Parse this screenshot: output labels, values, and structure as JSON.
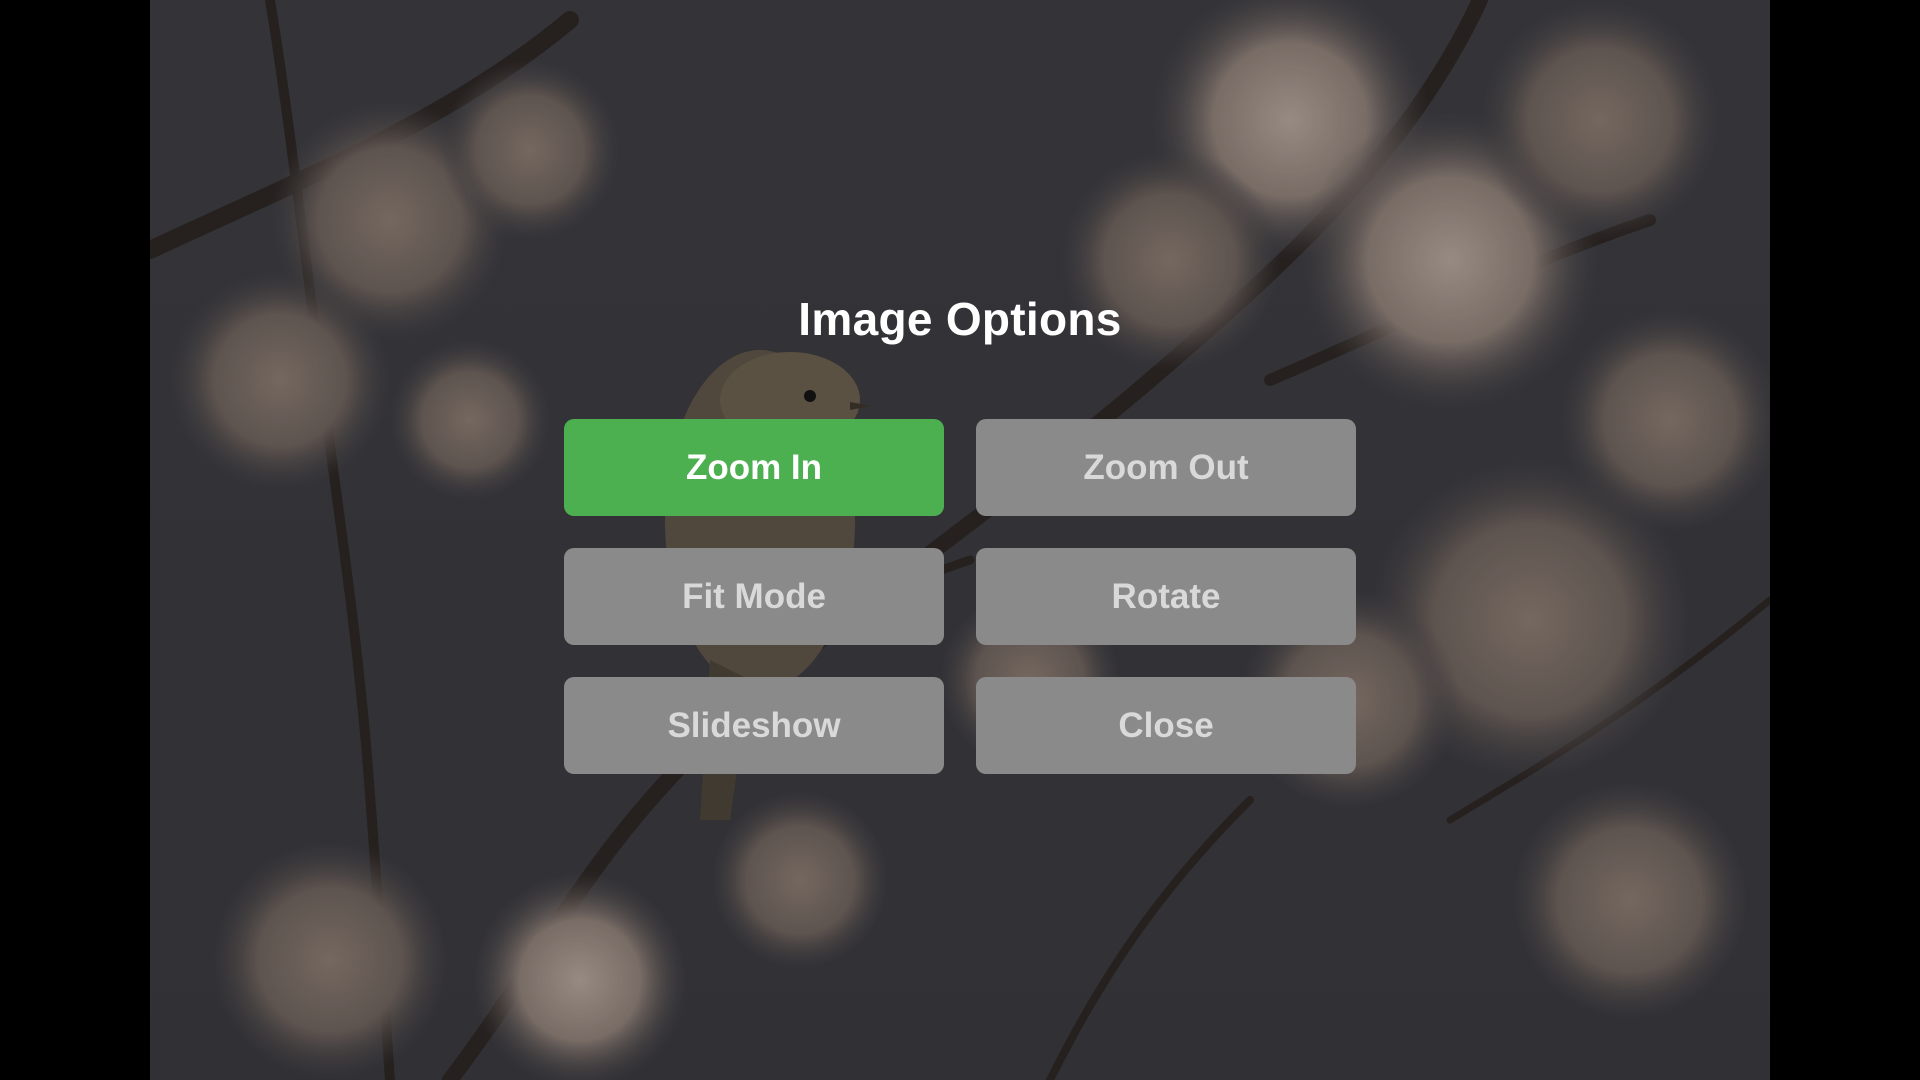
{
  "dialog": {
    "title": "Image Options",
    "buttons": [
      {
        "label": "Zoom In",
        "state": "selected"
      },
      {
        "label": "Zoom Out",
        "state": "default"
      },
      {
        "label": "Fit Mode",
        "state": "default"
      },
      {
        "label": "Rotate",
        "state": "default"
      },
      {
        "label": "Slideshow",
        "state": "default"
      },
      {
        "label": "Close",
        "state": "default"
      }
    ]
  },
  "colors": {
    "selected_button": "#4caf50",
    "default_button": "#8a8a8a",
    "letterbox": "#000000"
  }
}
